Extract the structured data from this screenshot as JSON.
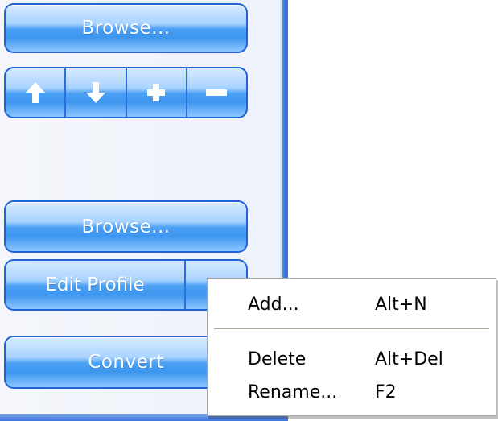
{
  "panel": {
    "browse_top_label": "Browse...",
    "browse_bottom_label": "Browse...",
    "edit_profile_label": "Edit Profile",
    "convert_label": "Convert",
    "icon_buttons": [
      {
        "icon": "arrow-up-icon"
      },
      {
        "icon": "arrow-down-icon"
      },
      {
        "icon": "plus-icon"
      },
      {
        "icon": "minus-icon"
      }
    ]
  },
  "context_menu": {
    "items": [
      {
        "label": "Add...",
        "shortcut": "Alt+N"
      },
      {
        "label": "Delete",
        "shortcut": "Alt+Del"
      },
      {
        "label": "Rename...",
        "shortcut": "F2"
      }
    ]
  },
  "colors": {
    "accent": "#3d96ef",
    "border": "#1f63d6",
    "panel_edge": "#2f6fdc"
  }
}
